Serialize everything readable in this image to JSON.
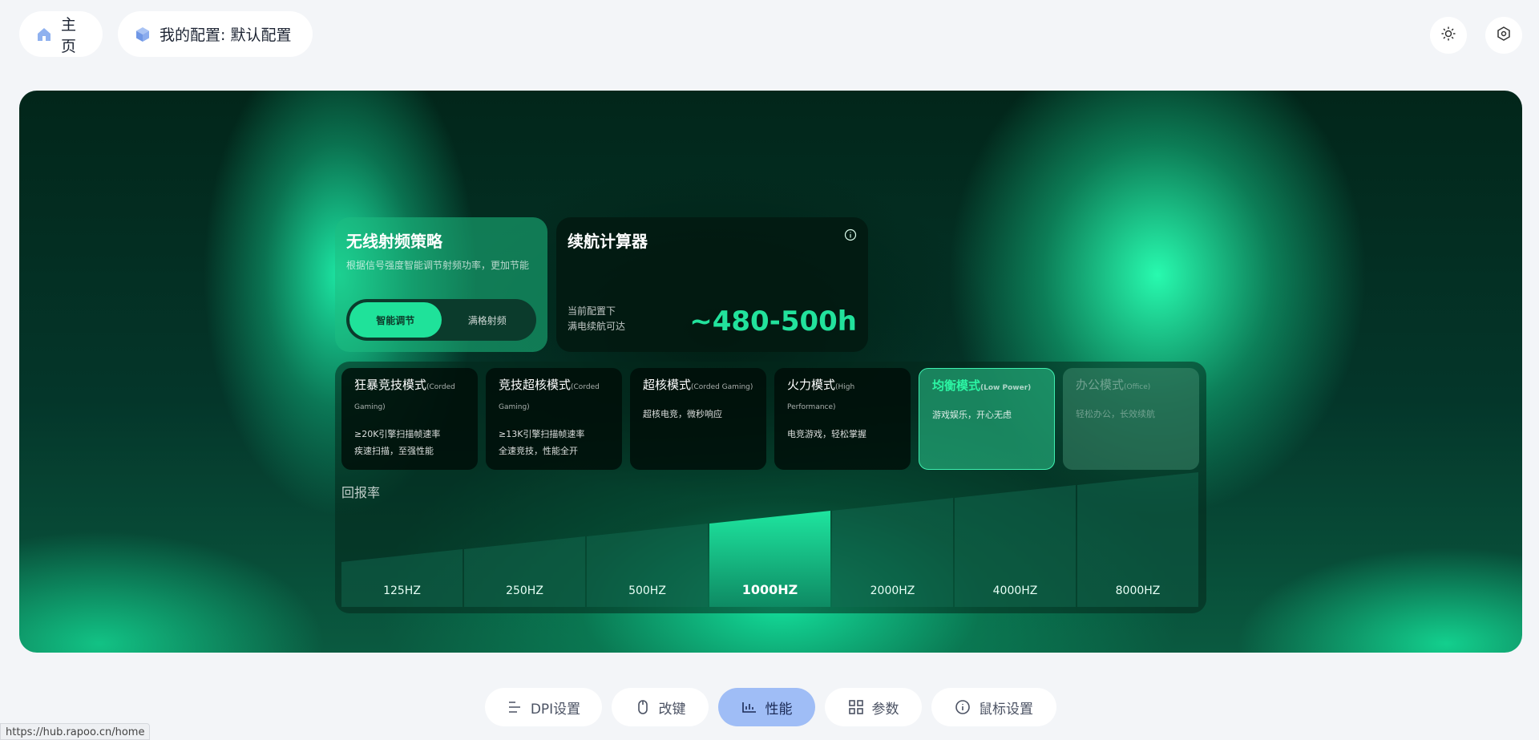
{
  "topbar": {
    "home_label": "主页",
    "profile_label": "我的配置: 默认配置",
    "home_icon": "home-icon",
    "profile_icon": "cube-icon",
    "theme_icon": "sun-icon",
    "settings_icon": "hexagon-settings-icon"
  },
  "wireless": {
    "title": "无线射频策略",
    "description": "根据信号强度智能调节射频功率，更加节能",
    "options": [
      "智能调节",
      "满格射频"
    ],
    "selected": "智能调节"
  },
  "battery": {
    "title": "续航计算器",
    "note_line1": "当前配置下",
    "note_line2": "满电续航可达",
    "value": "~480-500h"
  },
  "modes": [
    {
      "name": "狂暴竞技模式",
      "sub": "(Corded Gaming)",
      "desc1": "≥20K引擎扫描帧速率",
      "desc2": "疾速扫描，至强性能"
    },
    {
      "name": "竞技超核模式",
      "sub": "(Corded Gaming)",
      "desc1": "≥13K引擎扫描帧速率",
      "desc2": "全速竞技，性能全开"
    },
    {
      "name": "超核模式",
      "sub": "(Corded Gaming)",
      "desc1": "",
      "desc2": "超核电竞，微秒响应"
    },
    {
      "name": "火力模式",
      "sub": "(High Performance)",
      "desc1": "",
      "desc2": "电竞游戏，轻松掌握"
    },
    {
      "name": "均衡模式",
      "sub": "(Low Power)",
      "desc1": "",
      "desc2": "游戏娱乐，开心无虑"
    },
    {
      "name": "办公模式",
      "sub": "(Office)",
      "desc1": "",
      "desc2": "轻松办公，长效续航"
    }
  ],
  "selected_mode": "均衡模式",
  "polling": {
    "label": "回报率",
    "rates": [
      "125HZ",
      "250HZ",
      "500HZ",
      "1000HZ",
      "2000HZ",
      "4000HZ",
      "8000HZ"
    ],
    "selected": "1000HZ"
  },
  "nav": {
    "items": [
      {
        "label": "DPI设置",
        "icon": "sliders-icon"
      },
      {
        "label": "改键",
        "icon": "mouse-icon"
      },
      {
        "label": "性能",
        "icon": "performance-icon"
      },
      {
        "label": "参数",
        "icon": "grid-icon"
      },
      {
        "label": "鼠标设置",
        "icon": "info-icon"
      }
    ],
    "active": "性能"
  },
  "status_url": "https://hub.rapoo.cn/home",
  "colors": {
    "accent": "#22e29c",
    "nav_active": "#9fbdf6",
    "page_bg": "#f3f5f8"
  }
}
